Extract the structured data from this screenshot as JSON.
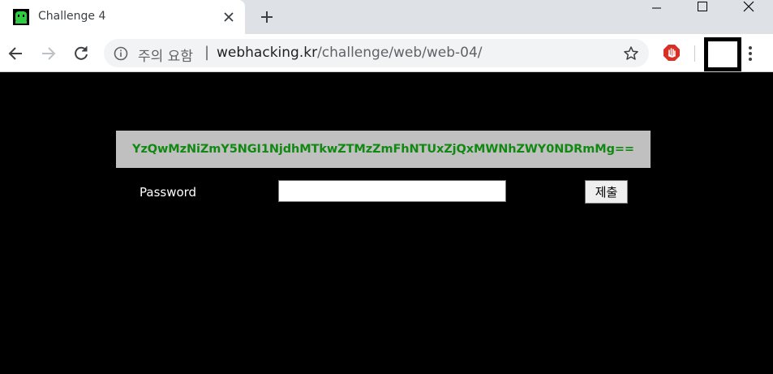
{
  "browser": {
    "tab": {
      "title": "Challenge 4",
      "favicon": "green-monster-icon"
    },
    "window_controls": [
      "minimize-icon",
      "maximize-icon",
      "close-icon"
    ],
    "address_bar": {
      "security_label": "주의 요함",
      "separator": "|",
      "host": "webhacking.kr",
      "path": "/challenge/web/web-04/"
    },
    "extension_icon": "stop-hand-icon",
    "accent_color": "#d93025"
  },
  "page": {
    "hash": "YzQwMzNiZmY5NGI1NjdhMTkwZTMzZmFhNTUxZjQxMWNhZWY0NDRmMg==",
    "hash_color": "#118811",
    "hash_bg": "#c0c0c0",
    "password_label": "Password",
    "password_value": "",
    "submit_label": "제출"
  }
}
